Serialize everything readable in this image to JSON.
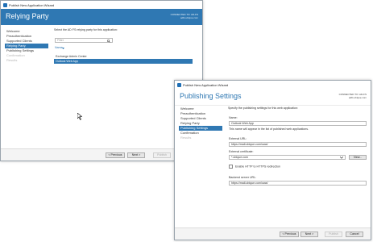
{
  "back_window": {
    "title": "Publish New Application Wizard",
    "heading": "Relying Party",
    "connection": {
      "line1": "CONNECTED TO: AD-FS",
      "line2": "adfs.ubique.com"
    },
    "nav": [
      {
        "label": "Welcome",
        "state": "normal"
      },
      {
        "label": "Preauthentication",
        "state": "normal"
      },
      {
        "label": "Supported Clients",
        "state": "normal"
      },
      {
        "label": "Relying Party",
        "state": "active"
      },
      {
        "label": "Publishing Settings",
        "state": "normal"
      },
      {
        "label": "Confirmation",
        "state": "dim"
      },
      {
        "label": "Results",
        "state": "dim"
      }
    ],
    "instruction": "Select the AD FS relying party for this application:",
    "filter_placeholder": "Filter",
    "sort_label": "Name",
    "list_header": "Exchange Admin Center",
    "list_selected": "Outlook Web App",
    "buttons": {
      "previous": "< Previous",
      "next": "Next >",
      "publish": "Publish",
      "cancel": "Cancel"
    }
  },
  "front_window": {
    "title": "Publish New Application Wizard",
    "heading": "Publishing Settings",
    "connection": {
      "line1": "CONNECTED TO: AD-FS",
      "line2": "adfs.ubique.com"
    },
    "nav": [
      {
        "label": "Welcome",
        "state": "normal"
      },
      {
        "label": "Preauthentication",
        "state": "normal"
      },
      {
        "label": "Supported Clients",
        "state": "normal"
      },
      {
        "label": "Relying Party",
        "state": "normal"
      },
      {
        "label": "Publishing Settings",
        "state": "active"
      },
      {
        "label": "Confirmation",
        "state": "normal"
      },
      {
        "label": "Results",
        "state": "dim"
      }
    ],
    "instruction": "Specify the publishing settings for this web application:",
    "name_label": "Name:",
    "name_value": "Outlook Web App",
    "name_hint": "This name will appear in the list of published web applications.",
    "external_url_label": "External URL:",
    "external_url_value": "https://mail.ubique.com/owa/",
    "cert_label": "External certificate:",
    "cert_value": "*.ubique.com",
    "view_button": "View...",
    "redirect_label": "Enable HTTP to HTTPS redirection",
    "backend_label": "Backend server URL:",
    "backend_value": "https://mail.ubique.com/owa/",
    "buttons": {
      "previous": "< Previous",
      "next": "Next >",
      "publish": "Publish",
      "cancel": "Cancel"
    }
  },
  "colors": {
    "accent": "#2f78b3"
  },
  "icons": {
    "search": "search-icon",
    "dropdown": "chevron-down-icon",
    "app": "wizard-app-icon",
    "cursor": "mouse-cursor-icon"
  }
}
